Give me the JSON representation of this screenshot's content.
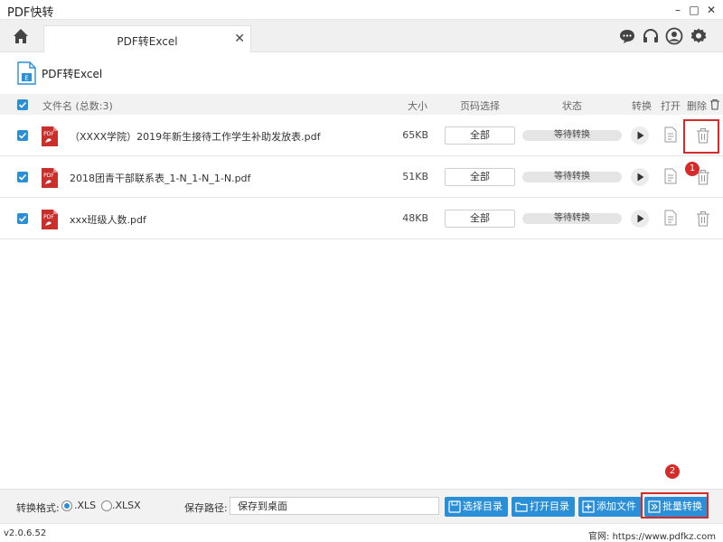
{
  "window": {
    "title": "PDF快转",
    "controls": [
      "–",
      "□",
      "✕"
    ]
  },
  "tabs": [
    {
      "label": "PDF转Excel",
      "close": "✕"
    }
  ],
  "section": {
    "title": "PDF转Excel"
  },
  "table": {
    "columns": {
      "filename": "文件名 (总数:3)",
      "size": "大小",
      "pages": "页码选择",
      "status": "状态",
      "convert": "转换",
      "open": "打开",
      "delete": "删除"
    },
    "rows": [
      {
        "name": "（XXXX学院）2019年新生接待工作学生补助发放表.pdf",
        "size": "65KB",
        "pages": "全部",
        "status": "等待转换",
        "checked": true
      },
      {
        "name": "2018团青干部联系表_1-N_1-N_1-N.pdf",
        "size": "51KB",
        "pages": "全部",
        "status": "等待转换",
        "checked": true
      },
      {
        "name": "xxx班级人数.pdf",
        "size": "48KB",
        "pages": "全部",
        "status": "等待转换",
        "checked": true
      }
    ]
  },
  "annotations": {
    "badge1": "1",
    "badge2": "2"
  },
  "bottom": {
    "format_label": "转换格式:",
    "options": [
      {
        "label": ".XLS",
        "selected": true
      },
      {
        "label": ".XLSX",
        "selected": false
      }
    ],
    "path_label": "保存路径:",
    "path_value": "保存到桌面",
    "buttons": {
      "choose_dir": "选择目录",
      "open_dir": "打开目录",
      "add_file": "添加文件",
      "batch_convert": "批量转换"
    }
  },
  "footer": {
    "version": "v2.0.6.52",
    "website": "官网: https://www.pdfkz.com"
  },
  "colors": {
    "accent": "#2a8fd6",
    "highlight": "#d42b2b",
    "pdf_red": "#c9302c",
    "excel_blue": "#2a8fd6"
  }
}
